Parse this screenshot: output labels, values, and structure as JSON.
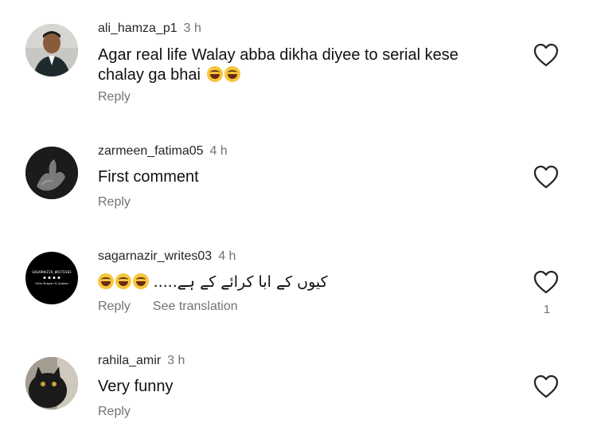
{
  "comments": [
    {
      "username": "ali_hamza_p1",
      "time": "3 h",
      "text": "Agar real life Walay abba dikha diyee to serial kese chalay ga bhai",
      "emoji_count": 2,
      "reply_label": "Reply",
      "avatar": "man-in-suit-photo",
      "icons": {
        "like": "heart-outline-icon"
      }
    },
    {
      "username": "zarmeen_fatima05",
      "time": "4 h",
      "text": "First comment",
      "reply_label": "Reply",
      "avatar": "dark-hand-photo",
      "icons": {
        "like": "heart-outline-icon"
      }
    },
    {
      "username": "sagarnazir_writes03",
      "time": "4 h",
      "text": "کیوں کے ابا کرائے کے ہے.....",
      "emoji_count": 3,
      "reply_label": "Reply",
      "translation_label": "See translation",
      "like_count": "1",
      "avatar": "brand-logo",
      "avatar_brand": {
        "name": "SAGARNAZIR_WRITES03",
        "tagline": "Urdu Shayari & Quotes"
      },
      "icons": {
        "like": "heart-outline-icon"
      }
    },
    {
      "username": "rahila_amir",
      "time": "3 h",
      "text": "Very funny",
      "reply_label": "Reply",
      "avatar": "black-cat-photo",
      "icons": {
        "like": "heart-outline-icon"
      }
    }
  ],
  "colors": {
    "text": "#111111",
    "secondary": "#737373",
    "background": "#ffffff",
    "emoji": "#f7c53c"
  }
}
